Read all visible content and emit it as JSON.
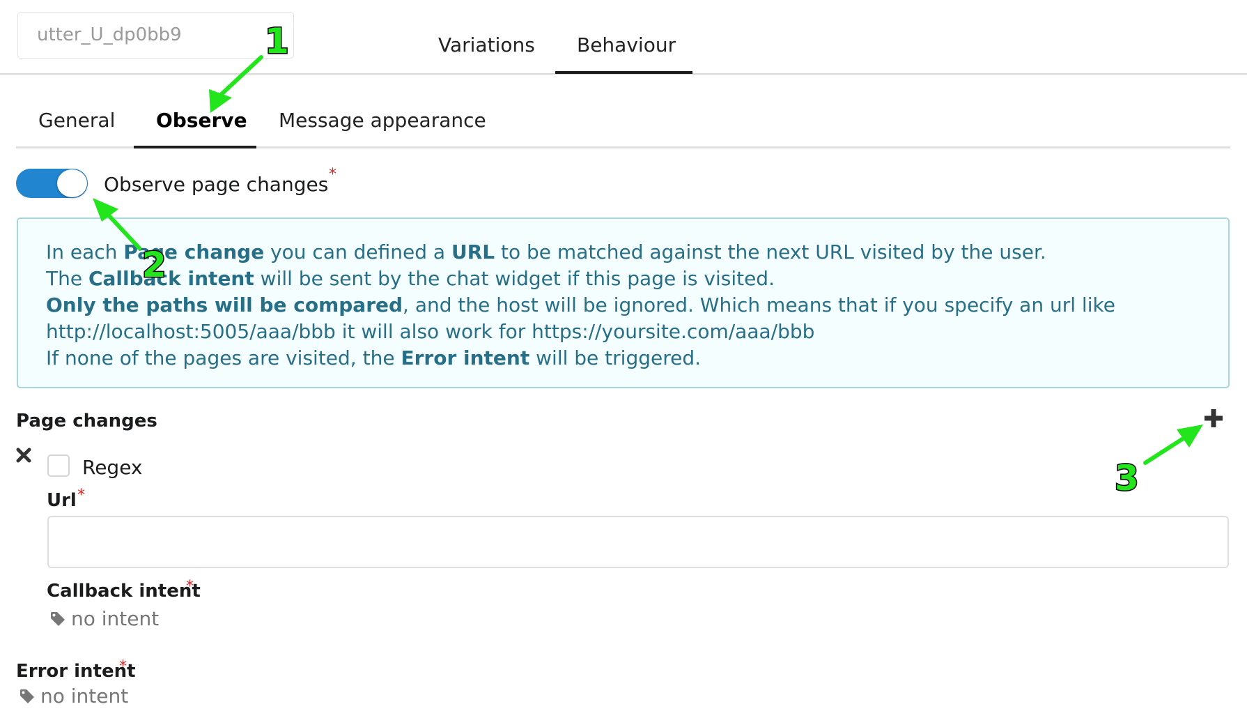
{
  "header": {
    "name_value": "utter_U_dp0bb9",
    "tabs": [
      {
        "label": "Variations",
        "active": false
      },
      {
        "label": "Behaviour",
        "active": true
      }
    ]
  },
  "subtabs": [
    {
      "label": "General",
      "active": false
    },
    {
      "label": "Observe",
      "active": true
    },
    {
      "label": "Message appearance",
      "active": false
    }
  ],
  "observe": {
    "toggle_label": "Observe page changes",
    "toggle_on": true,
    "required_mark": "*"
  },
  "info": {
    "line1": {
      "a": "In each ",
      "b": "Page change",
      "c": " you can defined a ",
      "d": "URL",
      "e": " to be matched against the next URL visited by the user."
    },
    "line2": {
      "a": "The ",
      "b": "Callback intent",
      "c": " will be sent by the chat widget if this page is visited."
    },
    "line3": {
      "a": "Only the paths will be compared",
      "b": ", and the host will be ignored. Which means that if you specify an url like"
    },
    "line4": "http://localhost:5005/aaa/bbb it will also work for https://yoursite.com/aaa/bbb",
    "line5": {
      "a": "If none of the pages are visited, the ",
      "b": "Error intent",
      "c": " will be triggered."
    }
  },
  "page_changes": {
    "title": "Page changes",
    "add_icon": "plus-icon",
    "remove_icon": "x-icon",
    "items": [
      {
        "regex_label": "Regex",
        "regex_checked": false,
        "url_label": "Url",
        "url_value": "",
        "callback_label": "Callback intent",
        "callback_value": "no intent"
      }
    ]
  },
  "error_intent": {
    "label": "Error intent",
    "value": "no intent"
  },
  "annotations": [
    "1",
    "2",
    "3"
  ],
  "colors": {
    "accent": "#2185d0",
    "info_text": "#276f86",
    "info_bg": "#f4fdff",
    "info_border": "#a9d5de",
    "required": "#db2828",
    "annotation_arrow": "#22e51c"
  }
}
